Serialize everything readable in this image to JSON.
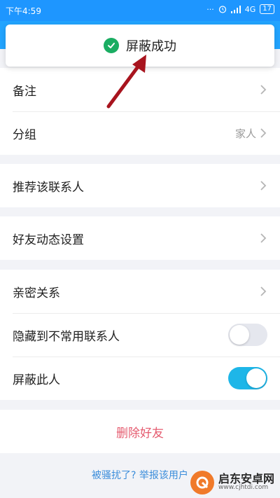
{
  "status_bar": {
    "time": "下午4:59",
    "dots": "···",
    "network": "4G",
    "battery": "17"
  },
  "toast": {
    "message": "屏蔽成功"
  },
  "settings": {
    "remark_label": "备注",
    "group_label": "分组",
    "group_value": "家人",
    "recommend_label": "推荐该联系人",
    "feed_settings_label": "好友动态设置",
    "intimacy_label": "亲密关系",
    "hide_label": "隐藏到不常用联系人",
    "hide_on": false,
    "block_label": "屏蔽此人",
    "block_on": true
  },
  "delete_friend_label": "删除好友",
  "report_link": "被骚扰了? 举报该用户",
  "watermark": {
    "title": "启东安卓网",
    "url": "www.cjhtdi.com"
  },
  "colors": {
    "header_blue": "#1e96ff",
    "toggle_on": "#1eb6e8",
    "delete_red": "#e55b6f",
    "link_blue": "#3b8ddb",
    "success_green": "#1aad62",
    "arrow_red": "#a8141e"
  }
}
